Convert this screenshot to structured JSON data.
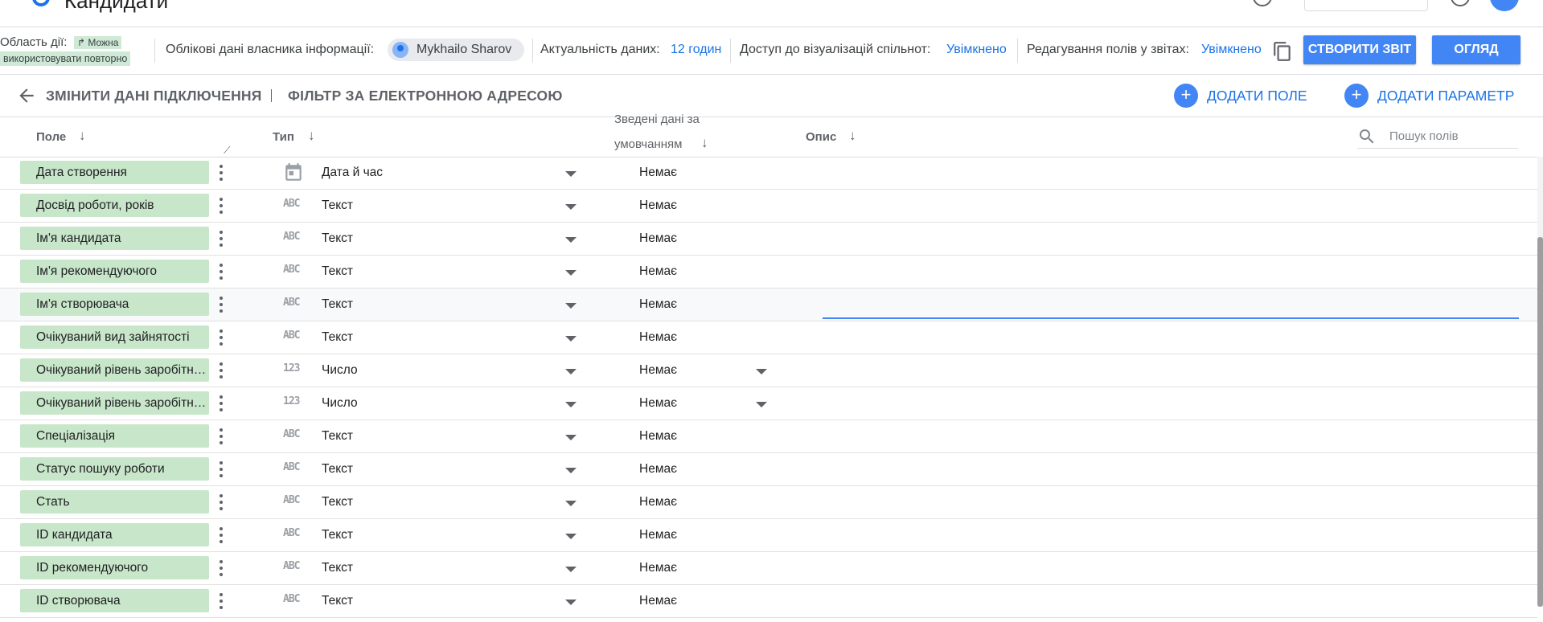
{
  "app": {
    "title": "Кандидати"
  },
  "info_bar": {
    "scope_label": "Область дії:",
    "scope_chip_line1": "↱ Можна",
    "scope_chip_line2": "використовувати повторно",
    "owner_label": "Облікові дані власника інформації:",
    "owner_name": "Mykhailo Sharov",
    "freshness_label": "Актуальність даних:",
    "freshness_value": "12 годин",
    "community_viz_label": "Доступ до візуалізацій спільнот:",
    "community_viz_value": "Увімкнено",
    "field_editing_label": "Редагування полів у звітах:",
    "field_editing_value": "Увімкнено",
    "create_report_button": "СТВОРИТИ ЗВІТ",
    "explore_button": "ОГЛЯД"
  },
  "toolbar": {
    "edit_connection": "ЗМІНИТИ ДАНІ ПІДКЛЮЧЕННЯ",
    "email_filter": "ФІЛЬТР ЗА ЕЛЕКТРОННОЮ АДРЕСОЮ",
    "add_field": "ДОДАТИ ПОЛЕ",
    "add_parameter": "ДОДАТИ ПАРАМЕТР"
  },
  "table": {
    "headers": {
      "field": "Поле",
      "type": "Тип",
      "aggregation_line1": "Зведені дані за",
      "aggregation_line2": "умовчанням",
      "description": "Опис"
    },
    "search_placeholder": "Пошук полів",
    "rows": [
      {
        "name": "Дата створення",
        "type_icon": "calendar-icon",
        "type": "Дата й час",
        "aggregation": "Немає"
      },
      {
        "name": "Досвід роботи, років",
        "type_icon": "ABC",
        "type": "Текст",
        "aggregation": "Немає"
      },
      {
        "name": "Ім'я кандидата",
        "type_icon": "ABC",
        "type": "Текст",
        "aggregation": "Немає"
      },
      {
        "name": "Ім'я рекомендуючого",
        "type_icon": "ABC",
        "type": "Текст",
        "aggregation": "Немає"
      },
      {
        "name": "Ім'я створювача",
        "type_icon": "ABC",
        "type": "Текст",
        "aggregation": "Немає"
      },
      {
        "name": "Очікуваний вид зайнятості",
        "type_icon": "ABC",
        "type": "Текст",
        "aggregation": "Немає"
      },
      {
        "name": "Очікуваний рівень заробітної плати",
        "type_icon": "123",
        "type": "Число",
        "aggregation": "Немає"
      },
      {
        "name": "Очікуваний рівень заробітної плати",
        "type_icon": "123",
        "type": "Число",
        "aggregation": "Немає"
      },
      {
        "name": "Спеціалізація",
        "type_icon": "ABC",
        "type": "Текст",
        "aggregation": "Немає"
      },
      {
        "name": "Статус пошуку роботи",
        "type_icon": "ABC",
        "type": "Текст",
        "aggregation": "Немає"
      },
      {
        "name": "Стать",
        "type_icon": "ABC",
        "type": "Текст",
        "aggregation": "Немає"
      },
      {
        "name": "ID кандидата",
        "type_icon": "ABC",
        "type": "Текст",
        "aggregation": "Немає"
      },
      {
        "name": "ID рекомендуючого",
        "type_icon": "ABC",
        "type": "Текст",
        "aggregation": "Немає"
      },
      {
        "name": "ID створювача",
        "type_icon": "ABC",
        "type": "Текст",
        "aggregation": "Немає"
      }
    ]
  },
  "colors": {
    "accent": "#4285f4",
    "link": "#1a73e8",
    "chip": "#c8e6c9"
  }
}
